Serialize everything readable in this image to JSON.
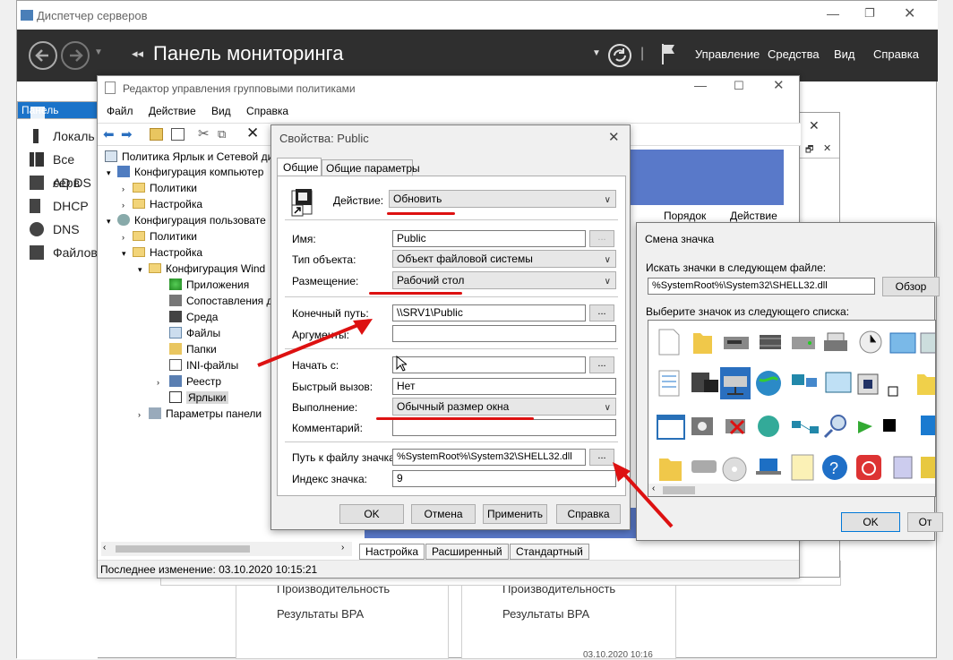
{
  "server_manager": {
    "window_title": "Диспетчер серверов",
    "header_title": "Панель мониторинга",
    "menu": [
      "Управление",
      "Средства",
      "Вид",
      "Справка"
    ],
    "nav": [
      "Панель",
      "Локаль",
      "Все серв",
      "AD DS",
      "DHCP",
      "DNS",
      "Файлов"
    ],
    "tiles": {
      "left": [
        "Производительность",
        "Результаты BPA"
      ],
      "right": [
        "Производительность",
        "Результаты BPA"
      ],
      "timestamp": "03.10.2020 10:16"
    }
  },
  "gpo_editor": {
    "title": "Редактор управления групповыми политиками",
    "menu": [
      "Файл",
      "Действие",
      "Вид",
      "Справка"
    ],
    "tree": {
      "root": "Политика Ярлык и Сетевой ди",
      "computer": "Конфигурация компьютер",
      "computer_children": [
        "Политики",
        "Настройка"
      ],
      "user": "Конфигурация пользовате",
      "user_children": [
        "Политики",
        "Настройка"
      ],
      "win_config": "Конфигурация Wind",
      "win_items": [
        "Приложения",
        "Сопоставления д",
        "Среда",
        "Файлы",
        "Папки",
        "INI-файлы",
        "Реестр",
        "Ярлыки"
      ],
      "control_panel": "Параметры панели"
    },
    "columns": [
      "Порядок",
      "Действие"
    ],
    "tabs": [
      "Настройка",
      "Расширенный",
      "Стандартный"
    ],
    "status": "Последнее изменение: 03.10.2020 10:15:21"
  },
  "props_dialog": {
    "title": "Свойства: Public",
    "tabs": [
      "Общие",
      "Общие параметры"
    ],
    "action_label": "Действие:",
    "action_value": "Обновить",
    "name_label": "Имя:",
    "name_value": "Public",
    "target_type_label": "Тип объекта:",
    "target_type_value": "Объект файловой системы",
    "location_label": "Размещение:",
    "location_value": "Рабочий стол",
    "target_path_label": "Конечный путь:",
    "target_path_value": "\\\\SRV1\\Public",
    "args_label": "Аргументы:",
    "start_in_label": "Начать с:",
    "shortcut_key_label": "Быстрый вызов:",
    "shortcut_key_value": "Нет",
    "run_label": "Выполнение:",
    "run_value": "Обычный размер окна",
    "comment_label": "Комментарий:",
    "icon_path_label": "Путь к файлу значка",
    "icon_path_value": "%SystemRoot%\\System32\\SHELL32.dll",
    "icon_index_label": "Индекс значка:",
    "icon_index_value": "9",
    "browse": "...",
    "buttons": [
      "OK",
      "Отмена",
      "Применить",
      "Справка"
    ]
  },
  "icon_dialog": {
    "title": "Смена значка",
    "search_label": "Искать значки в следующем файле:",
    "file_value": "%SystemRoot%\\System32\\SHELL32.dll",
    "browse_label": "Обзор",
    "select_label": "Выберите значок из следующего списка:",
    "ok_label": "OK",
    "cancel_label": "От"
  },
  "colors": {
    "accent": "#1b73c9",
    "annotation": "#dd1111",
    "header": "#2f2f2f"
  }
}
